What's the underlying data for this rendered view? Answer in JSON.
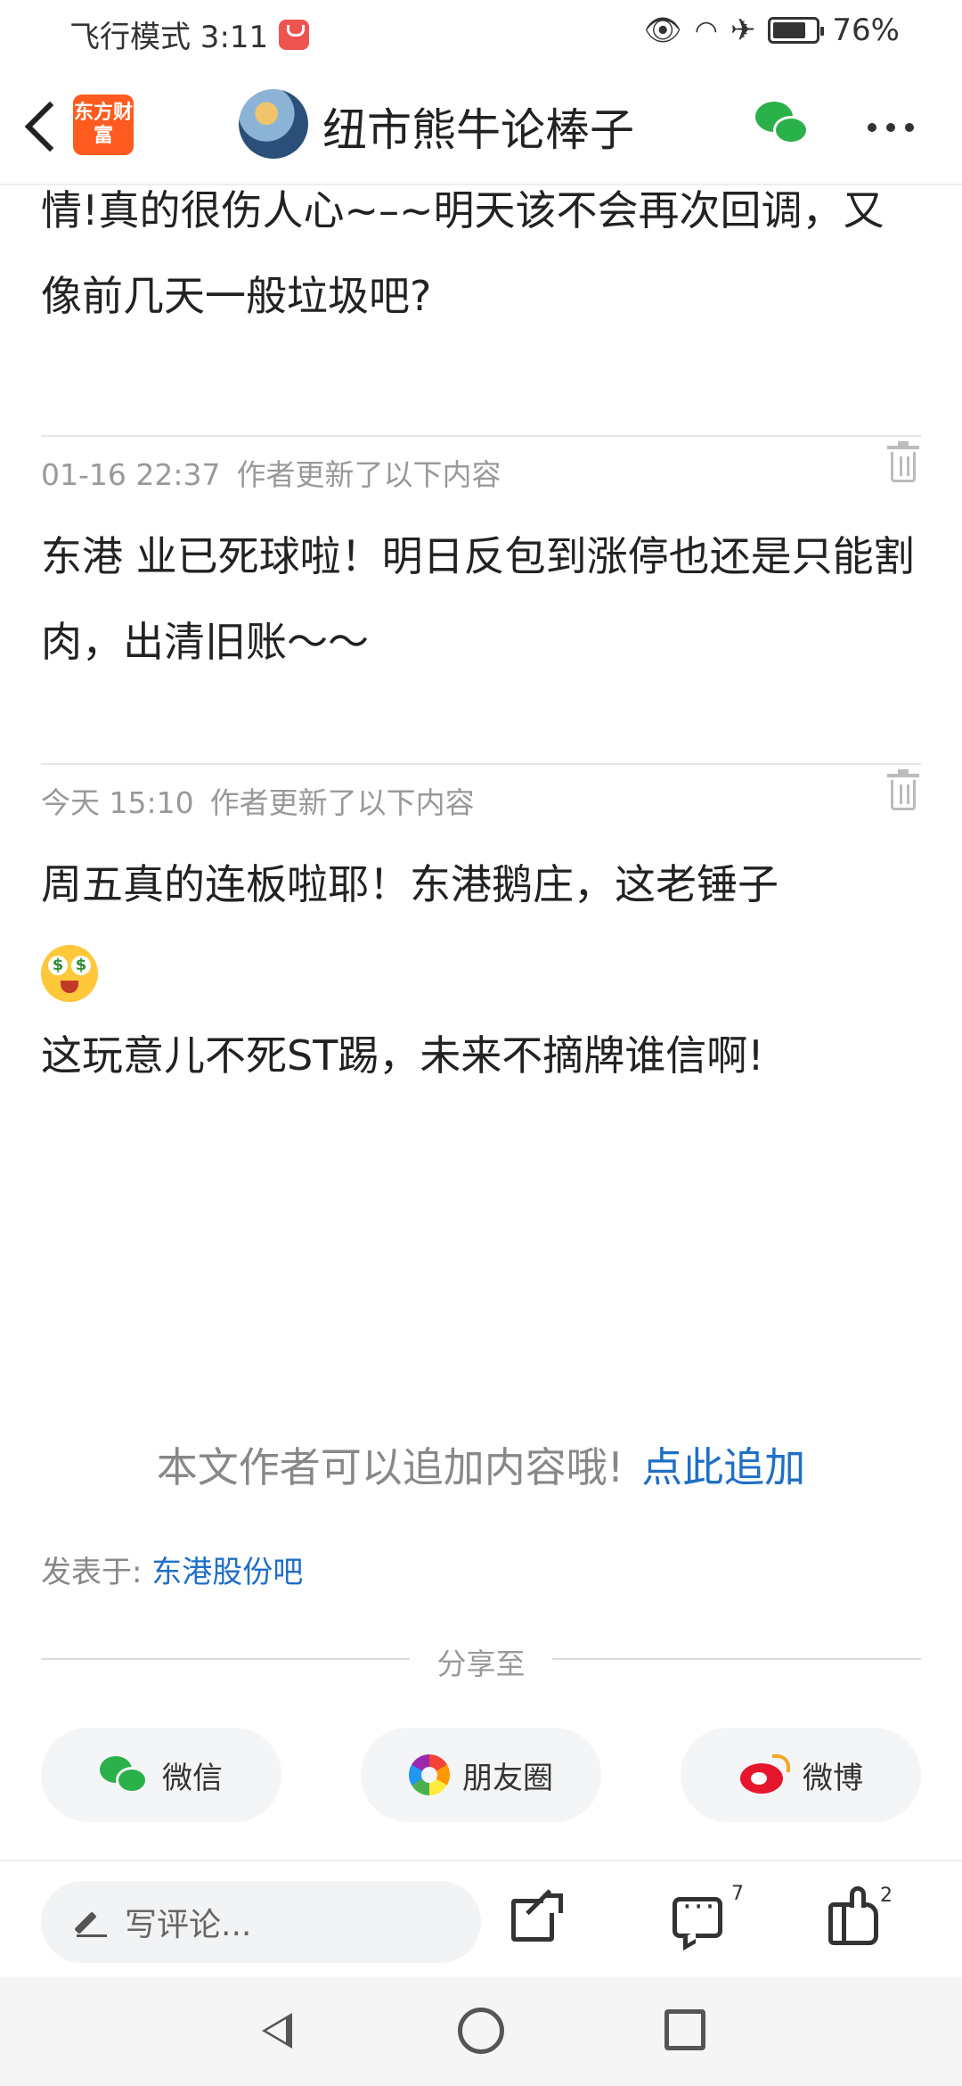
{
  "status_bar": {
    "left_text": "飞行模式 3:11",
    "battery": "76%"
  },
  "nav": {
    "brand": "东方财富",
    "title": "纽市熊牛论棒子"
  },
  "content": {
    "intro_text": "情!真的很伤人心~–~明天该不会再次回调，又像前几天一般垃圾吧?",
    "updates": [
      {
        "time": "01-16 22:37",
        "note": "作者更新了以下内容",
        "text": "东港 业已死球啦！明日反包到涨停也还是只能割肉，出清旧账～～"
      },
      {
        "time": "今天 15:10",
        "note": "作者更新了以下内容",
        "text_line1": "周五真的连板啦耶！东港鹅庄，这老锤子",
        "text_line2": "这玩意儿不死ST踢，未来不摘牌谁信啊!"
      }
    ]
  },
  "append": {
    "text": "本文作者可以追加内容哦!",
    "link": "点此追加"
  },
  "posted": {
    "label": "发表于:",
    "bar": "东港股份吧"
  },
  "share": {
    "title": "分享至",
    "buttons": [
      "微信",
      "朋友圈",
      "微博"
    ]
  },
  "action_bar": {
    "comment_placeholder": "写评论...",
    "comment_count": "7",
    "like_count": "2"
  }
}
